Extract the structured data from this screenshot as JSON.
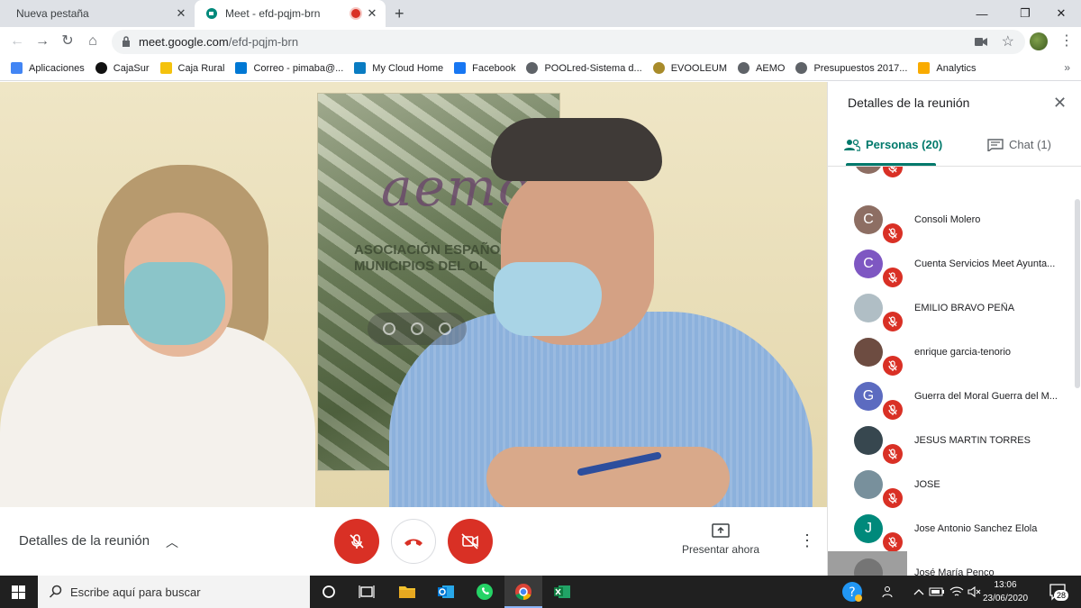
{
  "browser": {
    "tabs": [
      {
        "label": "Nueva pestaña"
      },
      {
        "label": "Meet - efd-pqjm-brn"
      }
    ],
    "url_host": "meet.google.com",
    "url_path": "/efd-pqjm-brn",
    "bookmarks": [
      {
        "label": "Aplicaciones",
        "icon": "apps-grid-icon",
        "color": "#4285f4"
      },
      {
        "label": "CajaSur",
        "icon": "cajasur-icon",
        "color": "#111111"
      },
      {
        "label": "Caja Rural",
        "icon": "caja-rural-icon",
        "color": "#f4c20d"
      },
      {
        "label": "Correo - pimaba@...",
        "icon": "outlook-icon",
        "color": "#0078d4"
      },
      {
        "label": "My Cloud Home",
        "icon": "cloud-icon",
        "color": "#0a7cc2"
      },
      {
        "label": "Facebook",
        "icon": "facebook-icon",
        "color": "#1877f2"
      },
      {
        "label": "POOLred-Sistema d...",
        "icon": "globe-icon",
        "color": "#5f6368"
      },
      {
        "label": "EVOOLEUM",
        "icon": "evooleum-icon",
        "color": "#a88b2a"
      },
      {
        "label": "AEMO",
        "icon": "globe-icon",
        "color": "#5f6368"
      },
      {
        "label": "Presupuestos 2017...",
        "icon": "globe-icon",
        "color": "#5f6368"
      },
      {
        "label": "Analytics",
        "icon": "analytics-icon",
        "color": "#f9ab00"
      }
    ],
    "bookmarks_more": "»"
  },
  "video": {
    "banner_logo": "aemo",
    "banner_text": "ASOCIACIÓN ESPAÑO DE MUNICIPIOS DEL OL"
  },
  "controls": {
    "details_label": "Detalles de la reunión",
    "present_label": "Presentar ahora"
  },
  "panel": {
    "title": "Detalles de la reunión",
    "people_tab": "Personas (20)",
    "chat_tab": "Chat (1)",
    "accent": "#00796b",
    "participants": [
      {
        "name": "Consoli Molero",
        "initial": "C",
        "avatar_color": "#8d6e63",
        "muted": true
      },
      {
        "name": "Cuenta Servicios Meet Ayunta...",
        "initial": "C",
        "avatar_color": "#7e57c2",
        "muted": true
      },
      {
        "name": "EMILIO BRAVO PEÑA",
        "initial": "",
        "avatar_color": "#b0bec5",
        "muted": true
      },
      {
        "name": "enrique garcia-tenorio",
        "initial": "",
        "avatar_color": "#6d4c41",
        "muted": true
      },
      {
        "name": "Guerra del Moral Guerra del M...",
        "initial": "G",
        "avatar_color": "#5c6bc0",
        "muted": true
      },
      {
        "name": "JESUS MARTIN TORRES",
        "initial": "",
        "avatar_color": "#37474f",
        "muted": true
      },
      {
        "name": "JOSE",
        "initial": "",
        "avatar_color": "#78909c",
        "muted": true
      },
      {
        "name": "Jose Antonio Sanchez Elola",
        "initial": "J",
        "avatar_color": "#00897b",
        "muted": true
      },
      {
        "name": "José María Penco",
        "initial": "",
        "avatar_color": "#757575",
        "muted": false
      }
    ]
  },
  "taskbar": {
    "search_placeholder": "Escribe aquí para buscar",
    "time": "13:06",
    "date": "23/06/2020",
    "notifications": "28"
  }
}
